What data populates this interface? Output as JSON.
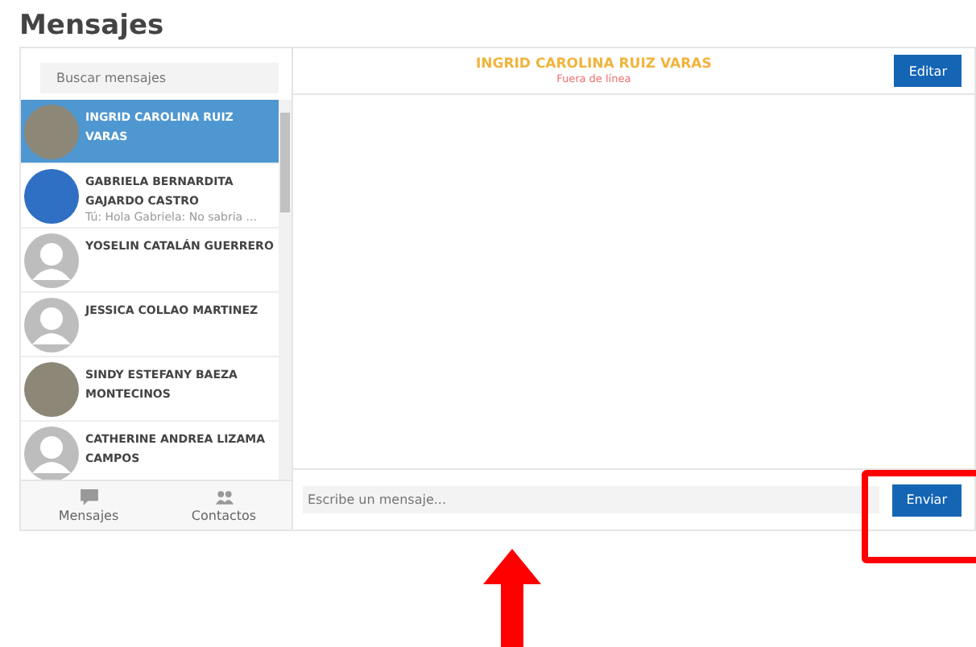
{
  "page_title": "Mensajes",
  "search": {
    "placeholder": "Buscar mensajes"
  },
  "conversations": [
    {
      "name": "INGRID CAROLINA RUIZ VARAS",
      "kind": "photo",
      "selected": true
    },
    {
      "name": "GABRIELA BERNARDITA GAJARDO CASTRO",
      "kind": "photo",
      "preview": "Tú: Hola Gabriela: No sabria ...",
      "selected": false
    },
    {
      "name": "YOSELIN CATALÁN GUERRERO",
      "kind": "default",
      "selected": false
    },
    {
      "name": "JESSICA COLLAO MARTINEZ",
      "kind": "default",
      "selected": false
    },
    {
      "name": "SINDY ESTEFANY BAEZA MONTECINOS",
      "kind": "photo",
      "selected": false
    },
    {
      "name": "CATHERINE ANDREA LIZAMA CAMPOS",
      "kind": "default",
      "selected": false
    }
  ],
  "bottom_tabs": [
    {
      "label": "Mensajes",
      "kind": "messages"
    },
    {
      "label": "Contactos",
      "kind": "contacts"
    }
  ],
  "chat": {
    "contact_name": "INGRID CAROLINA RUIZ VARAS",
    "status": "Fuera de línea",
    "edit_button": "Editar",
    "message_placeholder": "Escribe un mensaje...",
    "send_button": "Enviar"
  }
}
